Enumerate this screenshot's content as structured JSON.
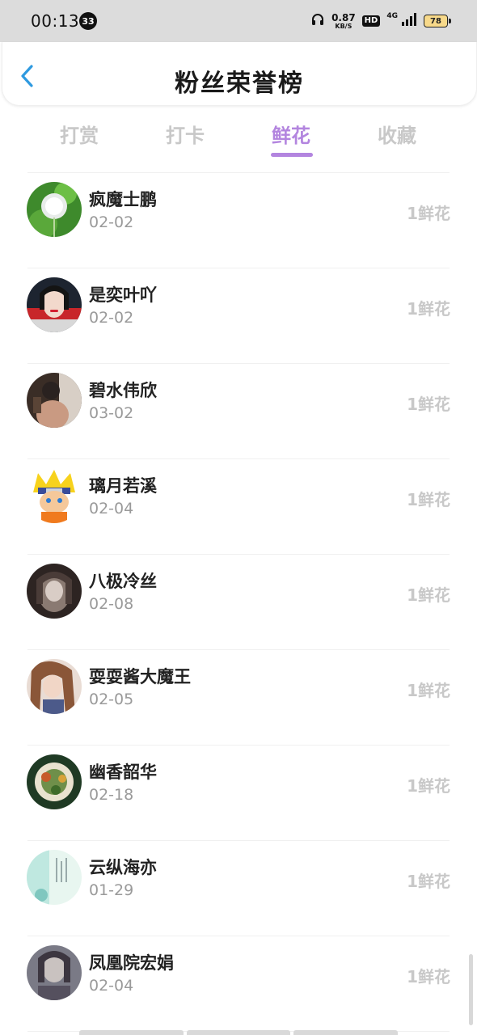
{
  "status_bar": {
    "time": "00:13",
    "notification_count": "33",
    "net_speed": "0.87",
    "net_unit": "KB/S",
    "hd": "HD",
    "network": "4G",
    "battery": "78"
  },
  "header": {
    "title": "粉丝荣誉榜",
    "back_icon": "chevron-left-icon"
  },
  "tabs": [
    {
      "label": "打赏",
      "active": false
    },
    {
      "label": "打卡",
      "active": false
    },
    {
      "label": "鲜花",
      "active": true
    },
    {
      "label": "收藏",
      "active": false
    }
  ],
  "colors": {
    "accent": "#b385df",
    "back_icon": "#2f9ae0",
    "muted": "#c8c8c8"
  },
  "fans": [
    {
      "name": "疯魔士鹏",
      "date": "02-02",
      "count": "1鲜花"
    },
    {
      "name": "是奕叶吖",
      "date": "02-02",
      "count": "1鲜花"
    },
    {
      "name": "碧水伟欣",
      "date": "03-02",
      "count": "1鲜花"
    },
    {
      "name": "璃月若溪",
      "date": "02-04",
      "count": "1鲜花"
    },
    {
      "name": "八极冷丝",
      "date": "02-08",
      "count": "1鲜花"
    },
    {
      "name": "耍耍酱大魔王",
      "date": "02-05",
      "count": "1鲜花"
    },
    {
      "name": "幽香韶华",
      "date": "02-18",
      "count": "1鲜花"
    },
    {
      "name": "云纵海亦",
      "date": "01-29",
      "count": "1鲜花"
    },
    {
      "name": "凤凰院宏娟",
      "date": "02-04",
      "count": "1鲜花"
    }
  ]
}
